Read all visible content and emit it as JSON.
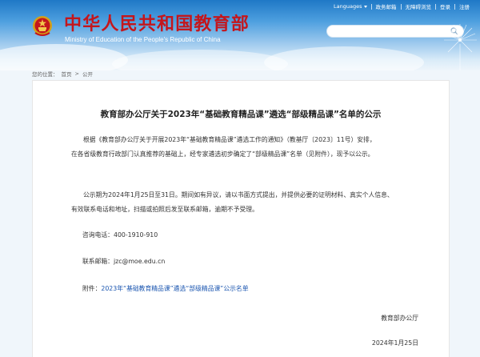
{
  "topnav": {
    "items": [
      "Languages",
      "政务邮箱",
      "无障碍浏览",
      "登录",
      "注册"
    ]
  },
  "site": {
    "title": "中华人民共和国教育部",
    "subtitle": "Ministry of Education of the People's Republic of China"
  },
  "search": {
    "placeholder": ""
  },
  "breadcrumb": {
    "prefix": "您的位置：",
    "home": "首页",
    "sep": ">",
    "current": "公开"
  },
  "notice": {
    "title": "教育部办公厅关于2023年“基础教育精品课”遴选“部级精品课”名单的公示",
    "para1": [
      "根据《教育部办公厅关于开展2023年“基础教育精品课”遴选工作的通知》（教基厅〔2023〕11号）安排，",
      "在各省级教育行政部门认真推荐的基础上，经专家遴选初步确定了“部级精品课”名单（见附件），现予以公示。"
    ],
    "para2": [
      "公示期为2024年1月25日至31日。期间如有异议，请以书面方式提出，并提供必要的证明材料、真实个人信息、",
      "有效联系电话和地址，扫描或拍照后发至联系邮箱，逾期不予受理。"
    ],
    "phone_label": "咨询电话：",
    "phone": "400-1910-910",
    "email_label": "联系邮箱：",
    "email": "jzc@moe.edu.cn",
    "attachment_label": "附件：",
    "attachment_link": "2023年“基础教育精品课”遴选“部级精品课”公示名单",
    "issuer": "教育部办公厅",
    "date": "2024年1月25日"
  },
  "colors": {
    "brand_red": "#c4161c",
    "header_blue": "#1f78c6",
    "link_blue": "#1b56b0"
  }
}
